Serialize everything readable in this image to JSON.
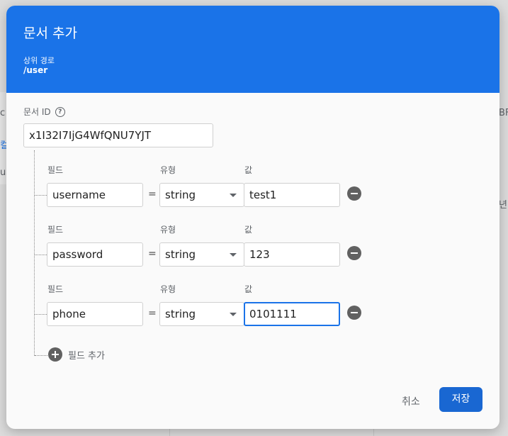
{
  "background": {
    "fragment_left_1": "c",
    "fragment_left_2": "컬",
    "fragment_left_3": "us",
    "fragment_right_1": "BF",
    "fragment_right_2": "년"
  },
  "dialog": {
    "title": "문서 추가",
    "parent_path_label": "상위 경로",
    "parent_path": "/user",
    "document_id_label": "문서 ID",
    "document_id_value": "x1I32I7IjG4WfQNU7YJT",
    "field_label": "필드",
    "type_label": "유형",
    "value_label": "값",
    "equals": "=",
    "fields": [
      {
        "name": "username",
        "type": "string",
        "value": "test1"
      },
      {
        "name": "password",
        "type": "string",
        "value": "123"
      },
      {
        "name": "phone",
        "type": "string",
        "value": "0101111"
      }
    ],
    "add_field_label": "필드 추가",
    "cancel_label": "취소",
    "save_label": "저장"
  },
  "colors": {
    "header": "#1a73e8",
    "save_button": "#1967d2",
    "focus_border": "#1a73e8"
  }
}
